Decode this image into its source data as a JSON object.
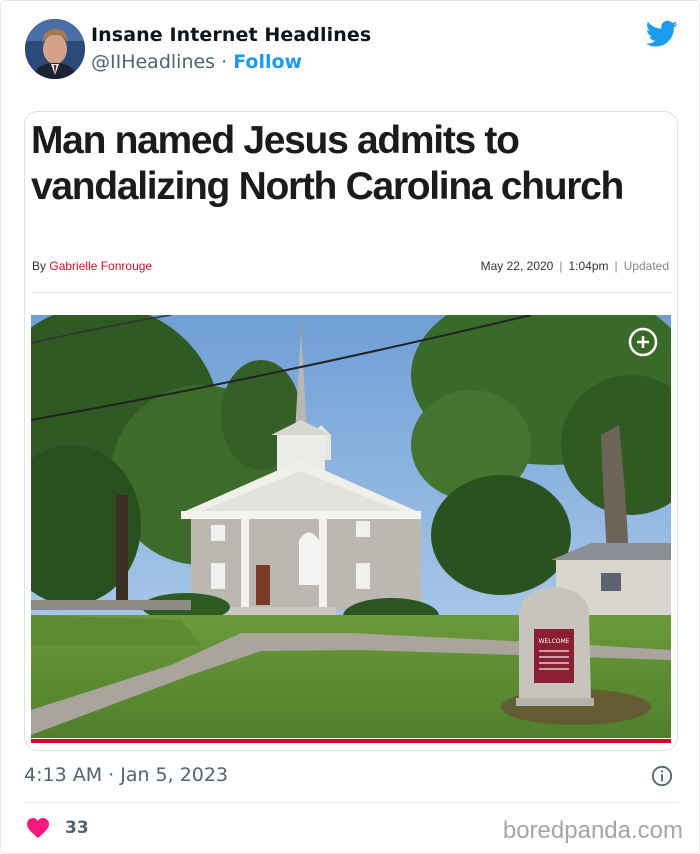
{
  "author": {
    "name": "Insane Internet Headlines",
    "handle": "@IIHeadlines",
    "separator": "·",
    "follow_label": "Follow"
  },
  "icons": {
    "brand": "twitter-bird-icon",
    "expand": "plus-circle-icon",
    "info": "info-icon",
    "like": "heart-icon"
  },
  "colors": {
    "twitter_blue": "#1d9bf0",
    "like_pink": "#f91880",
    "article_red": "#c8102e"
  },
  "article": {
    "headline": "Man named Jesus admits to vandalizing North Carolina church",
    "byline_prefix": "By",
    "byline_author": "Gabrielle Fonrouge",
    "date": "May 22, 2020",
    "time": "1:04pm",
    "updated_label": "Updated",
    "sign_text": "WELCOME"
  },
  "tweet": {
    "timestamp": "4:13 AM · Jan 5, 2023",
    "like_count": "33"
  },
  "watermark": "boredpanda.com"
}
